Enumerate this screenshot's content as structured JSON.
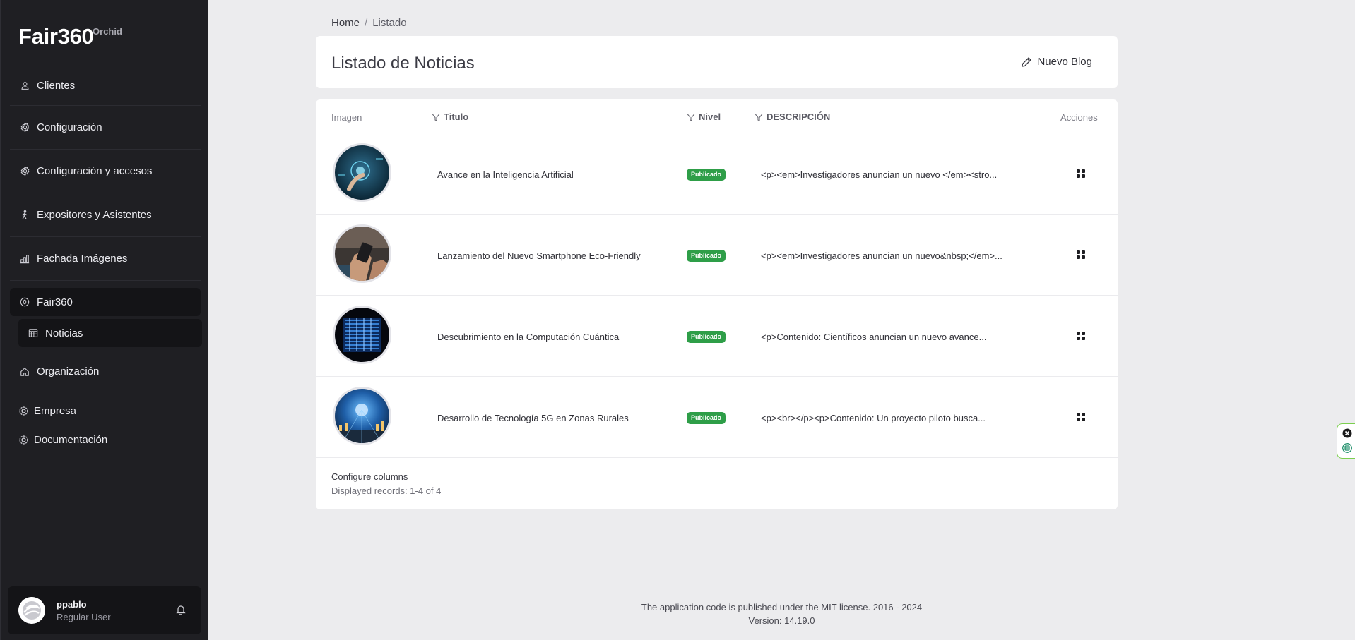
{
  "app": {
    "brand": "Fair360",
    "brand_sub": "Orchid"
  },
  "sidebar": {
    "items": [
      {
        "label": "Clientes",
        "icon": "user-icon"
      },
      {
        "label": "Configuración",
        "icon": "gear-icon"
      },
      {
        "label": "Configuración y accesos",
        "icon": "gear-icon"
      },
      {
        "label": "Expositores y Asistentes",
        "icon": "walking-person-icon"
      },
      {
        "label": "Fachada Imágenes",
        "icon": "bar-chart-icon"
      },
      {
        "label": "Fair360",
        "icon": "circle-zero-icon"
      },
      {
        "label": "Noticias",
        "icon": "calendar-grid-icon"
      },
      {
        "label": "Organización",
        "icon": "home-icon"
      },
      {
        "label": "Empresa",
        "icon": "cog-icon"
      },
      {
        "label": "Documentación",
        "icon": "cog-icon"
      }
    ]
  },
  "user": {
    "name": "ppablo",
    "role": "Regular User"
  },
  "breadcrumb": {
    "home": "Home",
    "separator": "/",
    "current": "Listado"
  },
  "header": {
    "title": "Listado de Noticias",
    "new_button": "Nuevo Blog"
  },
  "table": {
    "columns": {
      "image": "Imagen",
      "title": "Titulo",
      "level": "Nivel",
      "description": "DESCRIPCIÓN",
      "actions": "Acciones"
    },
    "rows": [
      {
        "title": "Avance en la Inteligencia Artificial",
        "status": "Publicado",
        "description": "<p><em>Investigadores anuncian un nuevo </em><stro..."
      },
      {
        "title": "Lanzamiento del Nuevo Smartphone Eco-Friendly",
        "status": "Publicado",
        "description": "<p><em>Investigadores anuncian un nuevo&nbsp;</em>..."
      },
      {
        "title": "Descubrimiento en la Computación Cuántica",
        "status": "Publicado",
        "description": "<p>Contenido: Científicos anuncian un nuevo avance..."
      },
      {
        "title": "Desarrollo de Tecnología 5G en Zonas Rurales",
        "status": "Publicado",
        "description": "<p><br></p><p>Contenido: Un proyecto piloto busca..."
      }
    ],
    "configure_columns": "Configure columns",
    "displayed_records": "Displayed records: 1-4 of 4"
  },
  "footer": {
    "license": "The application code is published under the MIT license. 2016 - 2024",
    "version": "Version: 14.19.0"
  },
  "colors": {
    "sidebar_bg": "#1f1f23",
    "badge_green": "#2e9e48",
    "page_bg": "#ececee",
    "widget_border": "#7ccf4f"
  }
}
